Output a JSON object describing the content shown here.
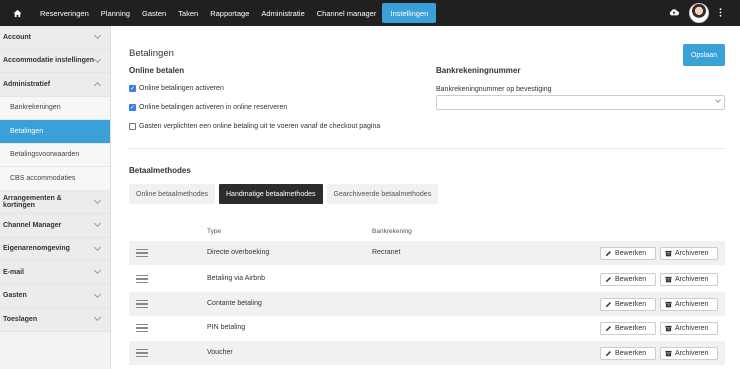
{
  "nav": {
    "items": [
      "Reserveringen",
      "Planning",
      "Gasten",
      "Taken",
      "Rapportage",
      "Administratie",
      "Channel manager",
      "Instellingen"
    ],
    "active": "Instellingen"
  },
  "sidebar": {
    "sections": [
      {
        "label": "Account"
      },
      {
        "label": "Accommodatie instellingen"
      },
      {
        "label": "Administratief",
        "expanded": true,
        "items": [
          "Bankrekeningen",
          "Betalingen",
          "Betalingsvoorwaarden",
          "CBS accommodaties"
        ],
        "active": "Betalingen"
      },
      {
        "label": "Arrangementen & kortingen"
      },
      {
        "label": "Channel Manager"
      },
      {
        "label": "Eigenarenomgeving"
      },
      {
        "label": "E-mail"
      },
      {
        "label": "Gasten"
      },
      {
        "label": "Toeslagen"
      }
    ]
  },
  "main": {
    "title": "Betalingen",
    "save_label": "Opslaan",
    "online": {
      "heading": "Online betalen",
      "options": [
        {
          "label": "Online betalingen activeren",
          "checked": true
        },
        {
          "label": "Online betalingen activeren in online reserveren",
          "checked": true
        },
        {
          "label": "Gasten verplichten een online betaling uit te voeren vanaf de checkout pagina",
          "checked": false
        }
      ]
    },
    "bank": {
      "heading": "Bankrekeningnummer",
      "label": "Bankrekeningnummer op bevestiging",
      "value": ""
    },
    "methods": {
      "heading": "Betaalmethodes",
      "tabs": [
        "Online betaalmethodes",
        "Handmatige betaalmethodes",
        "Gearchiveerde betaalmethodes"
      ],
      "active_tab": "Handmatige betaalmethodes",
      "columns": {
        "type": "Type",
        "bank": "Bankrekening"
      },
      "rows": [
        {
          "type": "Directe overboeking",
          "bank": "Recranet"
        },
        {
          "type": "Betaling via Airbnb",
          "bank": ""
        },
        {
          "type": "Contante betaling",
          "bank": ""
        },
        {
          "type": "PIN betaling",
          "bank": ""
        },
        {
          "type": "Voucher",
          "bank": ""
        }
      ],
      "edit_label": "Bewerken",
      "archive_label": "Archiveren"
    }
  },
  "colors": {
    "accent": "#3aa0d8",
    "nav_bg": "#202020"
  }
}
